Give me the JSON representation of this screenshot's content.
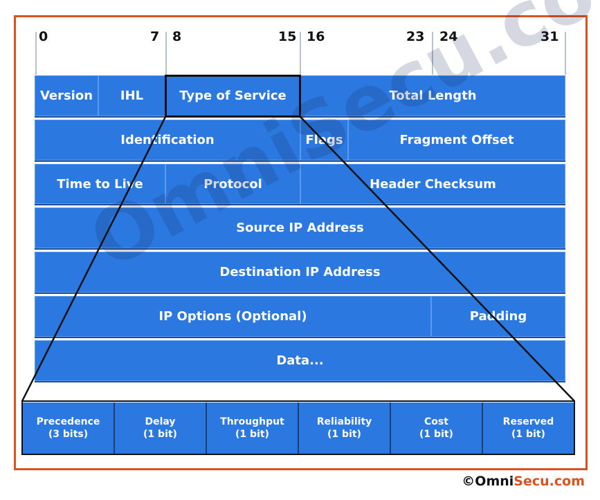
{
  "bit_positions": [
    "0",
    "7",
    "8",
    "15",
    "16",
    "23",
    "24",
    "31"
  ],
  "header_fields": {
    "row1": [
      "Version",
      "IHL",
      "Type of Service",
      "Total Length"
    ],
    "row2": [
      "Identification",
      "Flags",
      "Fragment Offset"
    ],
    "row3": [
      "Time to Live",
      "Protocol",
      "Header Checksum"
    ],
    "row4": [
      "Source IP Address"
    ],
    "row5": [
      "Destination IP Address"
    ],
    "row6": [
      "IP Options (Optional)",
      "Padding"
    ],
    "row7": [
      "Data..."
    ]
  },
  "tos_fields": [
    {
      "name": "Precedence",
      "size": "(3 bits)"
    },
    {
      "name": "Delay",
      "size": "(1 bit)"
    },
    {
      "name": "Throughput",
      "size": "(1 bit)"
    },
    {
      "name": "Reliability",
      "size": "(1 bit)"
    },
    {
      "name": "Cost",
      "size": "(1 bit)"
    },
    {
      "name": "Reserved",
      "size": "(1 bit)"
    }
  ],
  "watermark": "OmniSecu.com",
  "copyright": {
    "symbol": "©",
    "part1": "Omni",
    "part2": "Secu.com"
  },
  "colors": {
    "field_blue": "#2a78e0",
    "frame": "#d9531e"
  }
}
